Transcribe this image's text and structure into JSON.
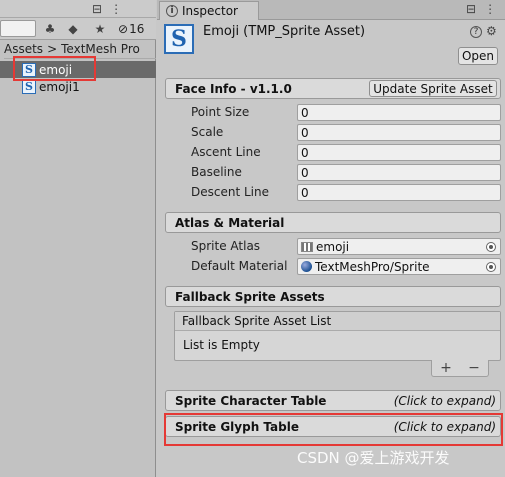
{
  "project_panel": {
    "top_icons": [
      "⊟",
      "⋮"
    ],
    "hidden_count": "16",
    "breadcrumb": {
      "root": "Assets",
      "sep": ">",
      "folder": "TextMesh Pro"
    },
    "items": [
      {
        "label": "emoji",
        "selected": true
      },
      {
        "label": "emoji1",
        "selected": false
      }
    ]
  },
  "inspector": {
    "tab_label": "Inspector",
    "top_icons": [
      "⊟",
      "⋮"
    ],
    "asset_title": "Emoji (TMP_Sprite Asset)",
    "open_label": "Open",
    "header_icon_letter": "S",
    "sections": {
      "face_info": {
        "title": "Face Info - v1.1.0",
        "button": "Update Sprite Asset",
        "fields": [
          {
            "label": "Point Size",
            "value": "0"
          },
          {
            "label": "Scale",
            "value": "0"
          },
          {
            "label": "Ascent Line",
            "value": "0"
          },
          {
            "label": "Baseline",
            "value": "0"
          },
          {
            "label": "Descent Line",
            "value": "0"
          }
        ]
      },
      "atlas": {
        "title": "Atlas & Material",
        "sprite_atlas_label": "Sprite Atlas",
        "sprite_atlas_value": "emoji",
        "material_label": "Default Material",
        "material_value": "TextMeshPro/Sprite"
      },
      "fallback": {
        "title": "Fallback Sprite Assets",
        "list_header": "Fallback Sprite Asset List",
        "empty_text": "List is Empty",
        "plus": "+",
        "minus": "−"
      },
      "char_table": {
        "title": "Sprite Character Table",
        "hint": "(Click to expand)"
      },
      "glyph_table": {
        "title": "Sprite Glyph Table",
        "hint": "(Click to expand)"
      }
    }
  },
  "watermark": "CSDN @爱上游戏开发",
  "colors": {
    "highlight": "#e53935",
    "selection": "#6a6a6a",
    "sprite_icon": "#2a6cb6"
  }
}
